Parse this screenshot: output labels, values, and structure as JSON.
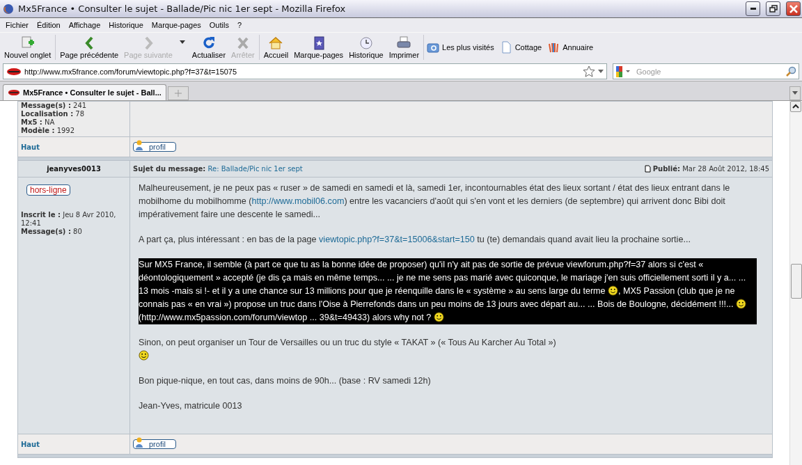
{
  "window": {
    "title": "Mx5France • Consulter le sujet - Ballade/Pic nic 1er sept - Mozilla Firefox"
  },
  "menu": [
    "Fichier",
    "Édition",
    "Affichage",
    "Historique",
    "Marque-pages",
    "Outils",
    "?"
  ],
  "toolbar": [
    [
      {
        "kind": "new-tab",
        "label": "Nouvel onglet",
        "disabled": false
      }
    ],
    [
      {
        "kind": "back",
        "label": "Page précédente",
        "disabled": false
      },
      {
        "kind": "forward",
        "label": "Page suivante",
        "disabled": true
      },
      {
        "kind": "dropdown",
        "disabled": false
      },
      {
        "kind": "reload",
        "label": "Actualiser",
        "disabled": false
      },
      {
        "kind": "stop",
        "label": "Arrêter",
        "disabled": true
      }
    ],
    [
      {
        "kind": "home",
        "label": "Accueil",
        "disabled": false
      },
      {
        "kind": "bookmarks",
        "label": "Marque-pages",
        "disabled": false
      },
      {
        "kind": "history",
        "label": "Historique",
        "disabled": false
      },
      {
        "kind": "print",
        "label": "Imprimer",
        "disabled": false
      }
    ]
  ],
  "bookmarks": [
    {
      "kind": "folder",
      "label": "Les plus visités"
    },
    {
      "kind": "page",
      "label": "Cottage"
    },
    {
      "kind": "bars",
      "label": "Annuaire"
    }
  ],
  "address": {
    "url": "http://www.mx5france.com/forum/viewtopic.php?f=37&t=15075"
  },
  "search": {
    "placeholder": "Google"
  },
  "tabs": [
    {
      "label": "Mx5France • Consulter le sujet - Ball...",
      "selected": true
    }
  ],
  "previous_post": {
    "info": [
      "**Message(s) :** 241",
      "**Localisation :** 78",
      "**Mx5 :** NA",
      "**Modèle :** 1992"
    ],
    "top_link": "Haut",
    "profile_button": "profil"
  },
  "post": {
    "author": "jeanyves0013",
    "status": "hors-ligne",
    "info": [
      "**Inscrit le :** Jeu 8 Avr 2010, 12:41",
      "**Message(s) :** 80"
    ],
    "subject_label": "Sujet du message:",
    "subject": "Re: Ballade/Pic nic 1er sept",
    "published_label": "Publié:",
    "published": "Mar 28 Août 2012, 18:45",
    "paragraphs": [
      {
        "selected": false,
        "segments": [
          {
            "kind": "text",
            "text": "Malheureusement, je ne peux pas « ruser » de samedi en samedi et là, samedi 1er, incontournables état des lieux sortant / état des lieux entrant dans le mobilhome du mobilhomme ("
          },
          {
            "kind": "link",
            "text": "http://www.mobil06.com"
          },
          {
            "kind": "text",
            "text": ") entre les vacanciers d'août qui s'en vont et les derniers (de septembre) qui arrivent donc Bibi doit impérativement faire une descente le samedi..."
          }
        ]
      },
      {
        "selected": false,
        "segments": [
          {
            "kind": "text",
            "text": "A part ça, plus intéressant : en bas de la page "
          },
          {
            "kind": "link",
            "text": "viewtopic.php?f=37&t=15006&start=150"
          },
          {
            "kind": "text",
            "text": " tu (te) demandais quand avait lieu la prochaine sortie..."
          }
        ]
      },
      {
        "selected": true,
        "segments": [
          {
            "kind": "text",
            "text": "Sur MX5 France, il semble (à part ce que tu as la bonne idée de proposer) qu'il n'y ait pas de sortie de prévue viewforum.php?f=37 alors si c'est « déontologiquement » accepté (je dis ça mais en même temps... ... je ne me sens pas marié avec quiconque, le mariage j'en suis officiellement sorti il y a... ... 13 mois -mais si !- et il y a une chance sur 13 millions pour que je réenquille dans le « système » au sens large du terme "
          },
          {
            "kind": "smiley"
          },
          {
            "kind": "text",
            "text": ", MX5 Passion (club que je ne connais pas « en vrai ») propose un truc dans l'Oise à Pierrefonds dans un peu moins de 13 jours avec départ au... ... Bois de Boulogne, décidément !!!... "
          },
          {
            "kind": "smiley"
          },
          {
            "kind": "text",
            "text": " (http://www.mx5passion.com/forum/viewtop ... 39&t=49433) alors why not ? "
          },
          {
            "kind": "smiley"
          }
        ]
      },
      {
        "selected": false,
        "segments": [
          {
            "kind": "text",
            "text": "Sinon, on peut organiser un Tour de Versailles ou un truc du style « TAKAT » (« Tous Au Karcher Au Total »)"
          },
          {
            "kind": "break"
          },
          {
            "kind": "smiley"
          }
        ]
      },
      {
        "selected": false,
        "segments": [
          {
            "kind": "text",
            "text": "Bon pique-nique, en tout cas, dans moins de 90h... (base : RV samedi 12h)"
          }
        ]
      },
      {
        "selected": false,
        "segments": [
          {
            "kind": "text",
            "text": "Jean-Yves, matricule 0013"
          }
        ]
      }
    ],
    "top_link": "Haut",
    "profile_button": "profil"
  }
}
